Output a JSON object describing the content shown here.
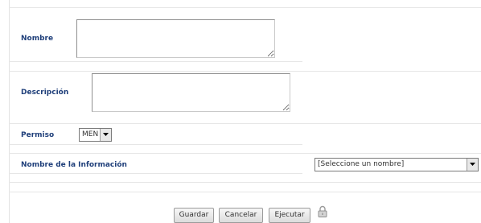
{
  "form": {
    "fields": {
      "nombre": {
        "label": "Nombre",
        "value": ""
      },
      "descripcion": {
        "label": "Descripción",
        "value": ""
      },
      "permiso": {
        "label": "Permiso",
        "selected": "MEN"
      },
      "nombre_informacion": {
        "label": "Nombre de la Información",
        "selected": "[Seleccione un nombre]"
      }
    },
    "buttons": {
      "guardar": "Guardar",
      "cancelar": "Cancelar",
      "ejecutar": "Ejecutar"
    },
    "icons": {
      "lock": "lock-icon"
    }
  }
}
